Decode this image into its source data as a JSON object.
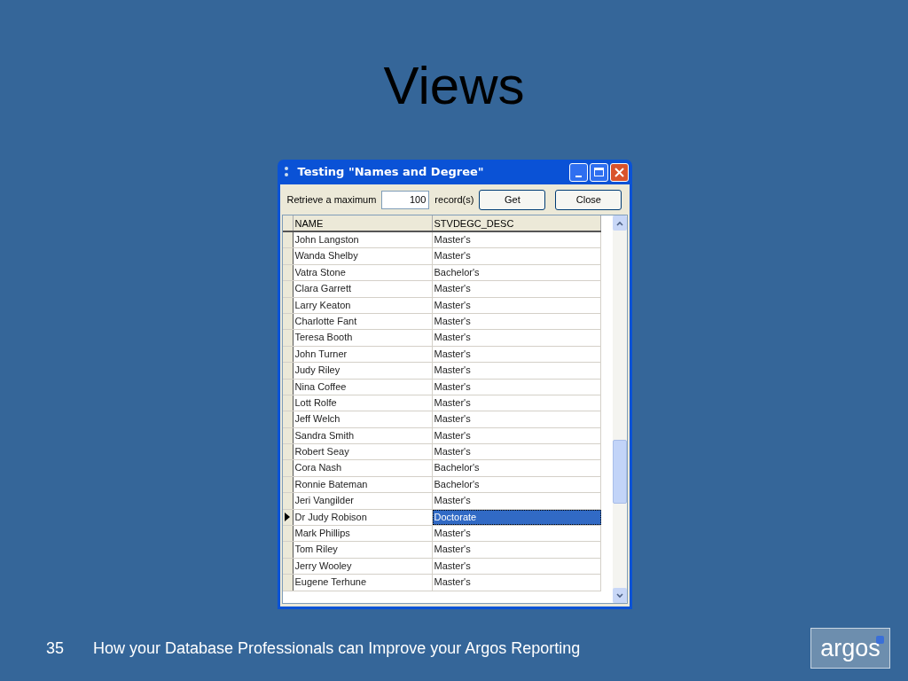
{
  "slide_title": "Views",
  "window": {
    "title": "Testing \"Names and Degree\""
  },
  "toolbar": {
    "label": "Retrieve a maximum",
    "max_value": "100",
    "suffix": "record(s)",
    "buttons": [
      "Get",
      "Close"
    ]
  },
  "table": {
    "columns": [
      "NAME",
      "STVDEGC_DESC"
    ],
    "rows": [
      {
        "name": "John Langston",
        "desc": "Master's",
        "selected": false
      },
      {
        "name": "Wanda Shelby",
        "desc": "Master's",
        "selected": false
      },
      {
        "name": "Vatra Stone",
        "desc": "Bachelor's",
        "selected": false
      },
      {
        "name": "Clara Garrett",
        "desc": "Master's",
        "selected": false
      },
      {
        "name": "Larry Keaton",
        "desc": "Master's",
        "selected": false
      },
      {
        "name": "Charlotte Fant",
        "desc": "Master's",
        "selected": false
      },
      {
        "name": "Teresa Booth",
        "desc": "Master's",
        "selected": false
      },
      {
        "name": "John Turner",
        "desc": "Master's",
        "selected": false
      },
      {
        "name": "Judy Riley",
        "desc": "Master's",
        "selected": false
      },
      {
        "name": "Nina Coffee",
        "desc": "Master's",
        "selected": false
      },
      {
        "name": "Lott Rolfe",
        "desc": "Master's",
        "selected": false
      },
      {
        "name": "Jeff Welch",
        "desc": "Master's",
        "selected": false
      },
      {
        "name": "Sandra Smith",
        "desc": "Master's",
        "selected": false
      },
      {
        "name": "Robert Seay",
        "desc": "Master's",
        "selected": false
      },
      {
        "name": "Cora Nash",
        "desc": "Bachelor's",
        "selected": false
      },
      {
        "name": "Ronnie Bateman",
        "desc": "Bachelor's",
        "selected": false
      },
      {
        "name": "Jeri Vangilder",
        "desc": "Master's",
        "selected": false
      },
      {
        "name": "Dr Judy Robison",
        "desc": "Doctorate",
        "selected": true
      },
      {
        "name": "Mark Phillips",
        "desc": "Master's",
        "selected": false
      },
      {
        "name": "Tom Riley",
        "desc": "Master's",
        "selected": false
      },
      {
        "name": "Jerry Wooley",
        "desc": "Master's",
        "selected": false
      },
      {
        "name": "Eugene Terhune",
        "desc": "Master's",
        "selected": false
      }
    ]
  },
  "footer": {
    "page_number": "35",
    "text": "How your Database Professionals can Improve your Argos Reporting",
    "logo": "argos"
  }
}
